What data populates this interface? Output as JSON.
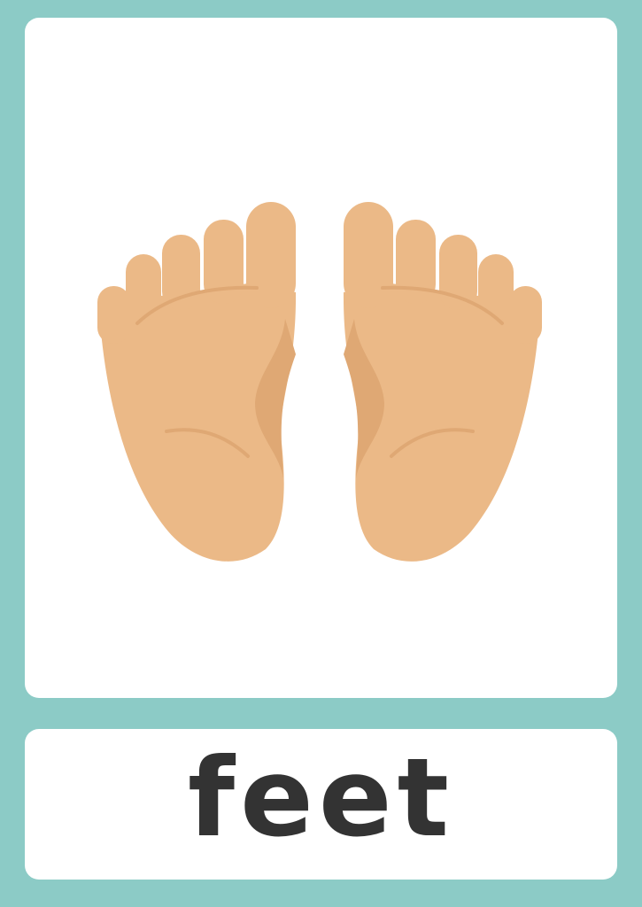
{
  "card": {
    "word": "feet",
    "illustration": "feet-soles-icon"
  },
  "colors": {
    "border": "#8ccbc6",
    "skin": "#ebb987",
    "skin_shade": "#dfa874",
    "text": "#333333"
  }
}
